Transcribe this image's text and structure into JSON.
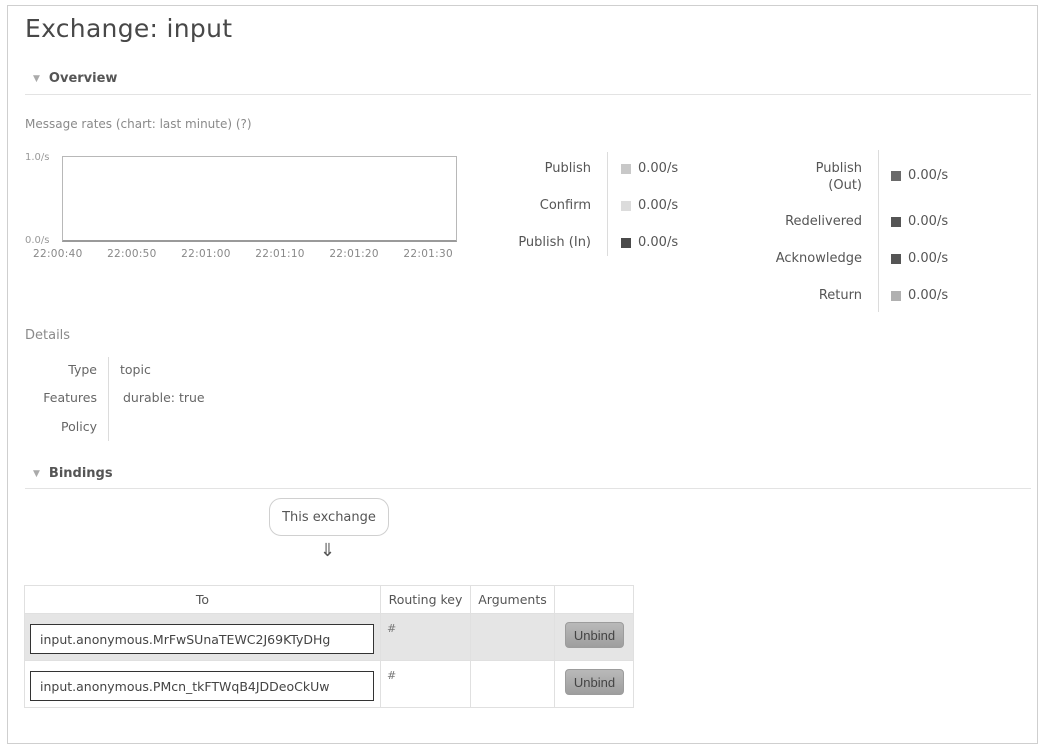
{
  "page": {
    "title": "Exchange: input"
  },
  "overview": {
    "heading": "Overview",
    "rates_label": "Message rates (chart: last minute) (?)",
    "chart_data": {
      "type": "line",
      "y_top_label": "1.0/s",
      "y_bottom_label": "0.0/s",
      "x_ticks": [
        "22:00:40",
        "22:00:50",
        "22:01:00",
        "22:01:10",
        "22:01:20",
        "22:01:30"
      ]
    },
    "rates_left": [
      {
        "label": "Publish",
        "value": "0.00/s",
        "color": "#c8c8c8"
      },
      {
        "label": "Confirm",
        "value": "0.00/s",
        "color": "#dcdcdc"
      },
      {
        "label": "Publish (In)",
        "value": "0.00/s",
        "color": "#4a4a4a"
      }
    ],
    "rates_right": [
      {
        "label": "Publish\n(Out)",
        "value": "0.00/s",
        "color": "#6a6a6a"
      },
      {
        "label": "Redelivered",
        "value": "0.00/s",
        "color": "#555555"
      },
      {
        "label": "Acknowledge",
        "value": "0.00/s",
        "color": "#555555"
      },
      {
        "label": "Return",
        "value": "0.00/s",
        "color": "#b0b0b0"
      }
    ]
  },
  "details": {
    "heading": "Details",
    "type_label": "Type",
    "type_value": "topic",
    "features_label": "Features",
    "features_value": "durable: true",
    "policy_label": "Policy"
  },
  "bindings": {
    "heading": "Bindings",
    "this_exchange": "This exchange",
    "arrow": "⇓",
    "columns": {
      "to": "To",
      "routing_key": "Routing key",
      "arguments": "Arguments"
    },
    "rows": [
      {
        "to": "input.anonymous.MrFwSUnaTEWC2J69KTyDHg",
        "routing_key": "#",
        "button": "Unbind"
      },
      {
        "to": "input.anonymous.PMcn_tkFTWqB4JDDeoCkUw",
        "routing_key": "#",
        "button": "Unbind"
      }
    ]
  }
}
